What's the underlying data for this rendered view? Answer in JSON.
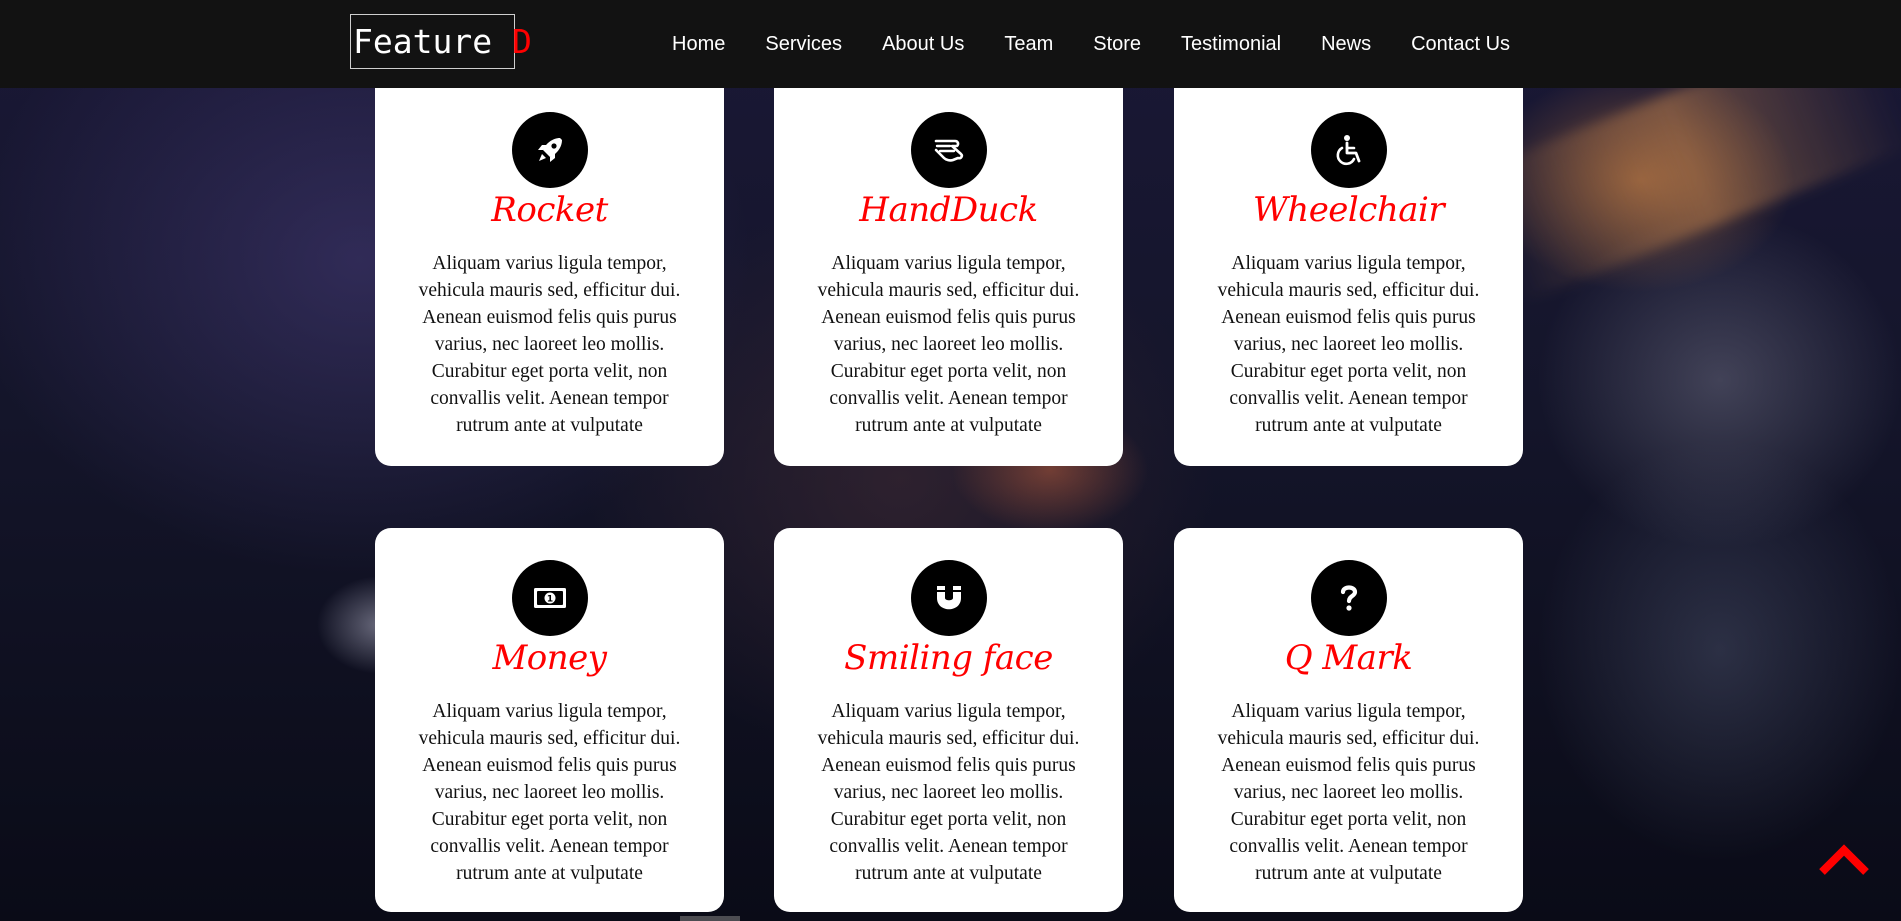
{
  "brand": {
    "name": "Feature",
    "accent_letter": "D",
    "accent_color": "#ff0000"
  },
  "nav": {
    "items": [
      {
        "label": "Home"
      },
      {
        "label": "Services"
      },
      {
        "label": "About Us"
      },
      {
        "label": "Team"
      },
      {
        "label": "Store"
      },
      {
        "label": "Testimonial"
      },
      {
        "label": "News"
      },
      {
        "label": "Contact Us"
      }
    ]
  },
  "features": [
    {
      "icon": "rocket-icon",
      "title": "Rocket",
      "text": "Aliquam varius ligula tempor, vehicula mauris sed, efficitur dui. Aenean euismod felis quis purus varius, nec laoreet leo mollis. Curabitur eget porta velit, non convallis velit. Aenean tempor rutrum ante at vulputate"
    },
    {
      "icon": "hand-icon",
      "title": "HandDuck",
      "text": "Aliquam varius ligula tempor, vehicula mauris sed, efficitur dui. Aenean euismod felis quis purus varius, nec laoreet leo mollis. Curabitur eget porta velit, non convallis velit. Aenean tempor rutrum ante at vulputate"
    },
    {
      "icon": "wheelchair-icon",
      "title": "Wheelchair",
      "text": "Aliquam varius ligula tempor, vehicula mauris sed, efficitur dui. Aenean euismod felis quis purus varius, nec laoreet leo mollis. Curabitur eget porta velit, non convallis velit. Aenean tempor rutrum ante at vulputate"
    },
    {
      "icon": "money-icon",
      "title": "Money",
      "text": "Aliquam varius ligula tempor, vehicula mauris sed, efficitur dui. Aenean euismod felis quis purus varius, nec laoreet leo mollis. Curabitur eget porta velit, non convallis velit. Aenean tempor rutrum ante at vulputate"
    },
    {
      "icon": "magnet-icon",
      "title": "Smiling face",
      "text": "Aliquam varius ligula tempor, vehicula mauris sed, efficitur dui. Aenean euismod felis quis purus varius, nec laoreet leo mollis. Curabitur eget porta velit, non convallis velit. Aenean tempor rutrum ante at vulputate"
    },
    {
      "icon": "question-mark-icon",
      "title": "Q Mark",
      "text": "Aliquam varius ligula tempor, vehicula mauris sed, efficitur dui. Aenean euismod felis quis purus varius, nec laoreet leo mollis. Curabitur eget porta velit, non convallis velit. Aenean tempor rutrum ante at vulputate"
    }
  ],
  "colors": {
    "nav_background": "#121212",
    "title_accent": "#ff0000",
    "icon_background": "#000000",
    "back_to_top": "#ff0000"
  },
  "back_to_top": {
    "icon": "chevron-up-icon"
  }
}
